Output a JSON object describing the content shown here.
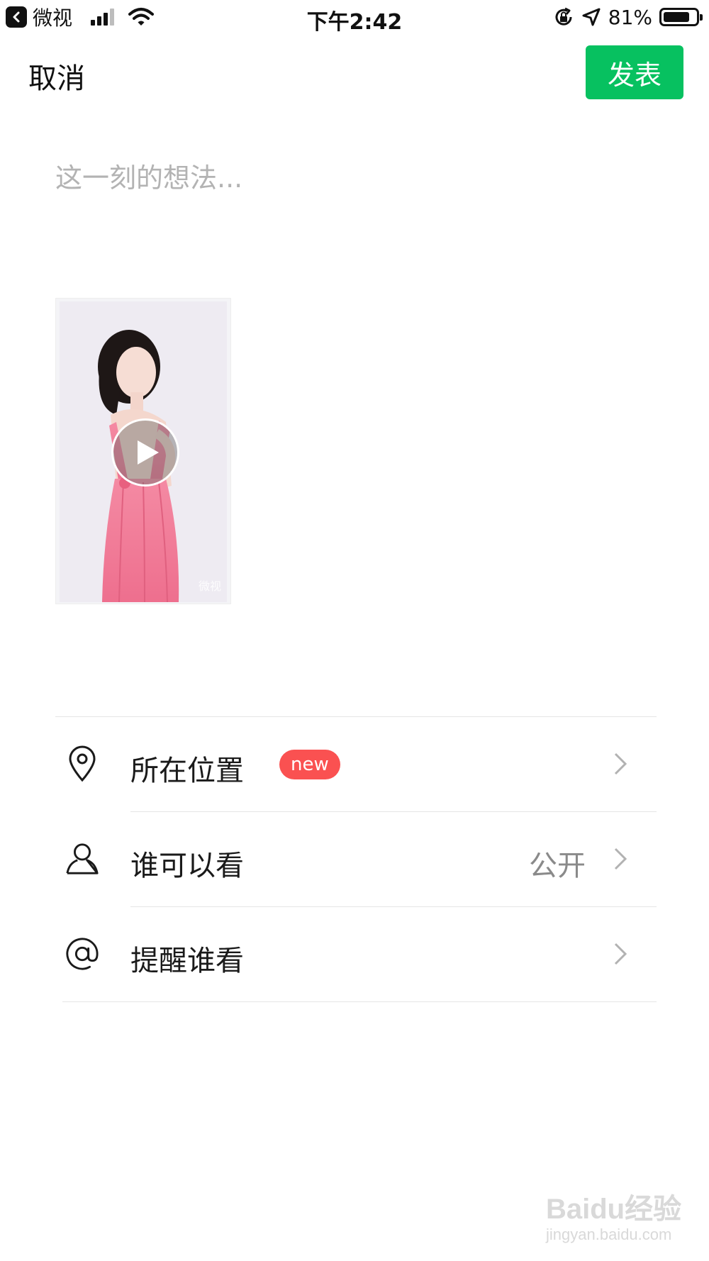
{
  "status_bar": {
    "back_app_name": "微视",
    "time": "下午2:42",
    "battery_percent": "81%",
    "battery_level": 0.81,
    "signal_bars_active": 3,
    "signal_bars_total": 4
  },
  "nav": {
    "cancel_label": "取消",
    "publish_label": "发表",
    "publish_color": "#07C160"
  },
  "composer": {
    "placeholder": "这一刻的想法..."
  },
  "media": {
    "type": "video",
    "watermark": "微视"
  },
  "options": [
    {
      "icon": "location-pin-icon",
      "label": "所在位置",
      "badge": "new",
      "value": ""
    },
    {
      "icon": "person-icon",
      "label": "谁可以看",
      "badge": "",
      "value": "公开"
    },
    {
      "icon": "at-sign-icon",
      "label": "提醒谁看",
      "badge": "",
      "value": ""
    }
  ],
  "watermark": {
    "brand": "Baidu经验",
    "url": "jingyan.baidu.com"
  }
}
